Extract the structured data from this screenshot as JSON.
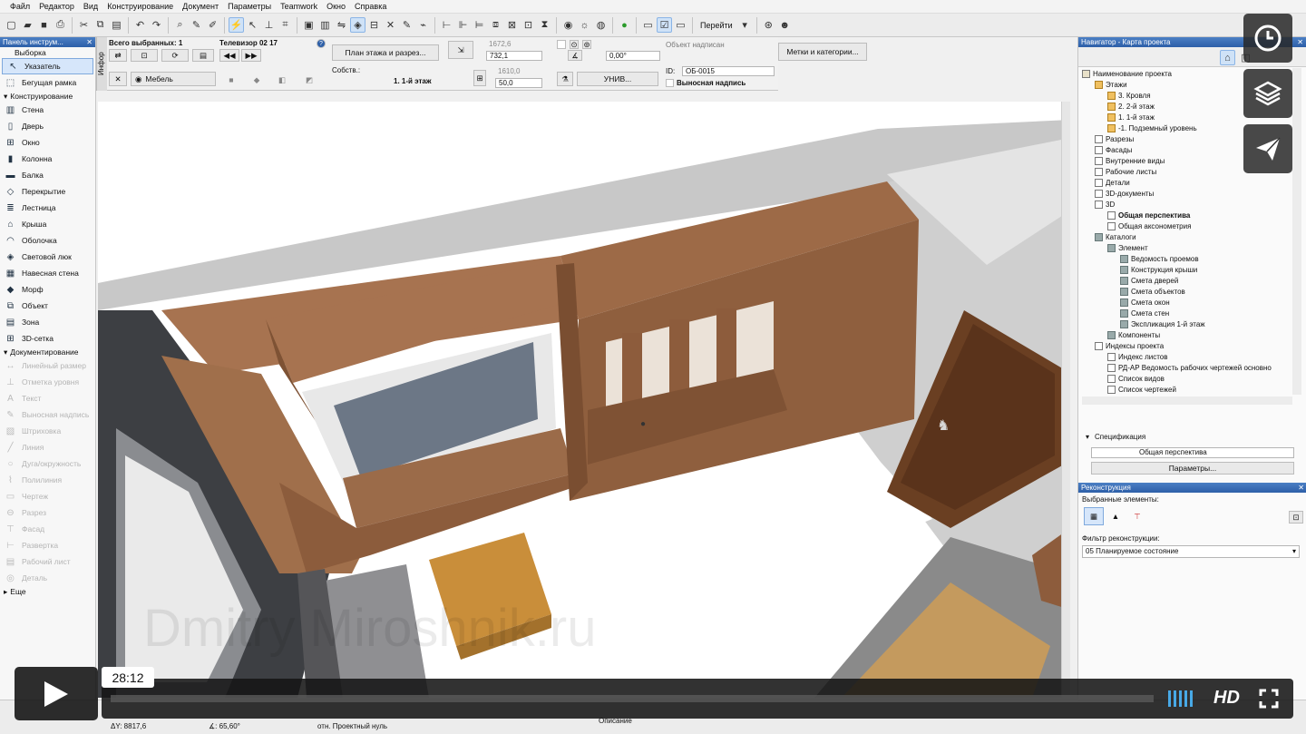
{
  "menu": [
    "Файл",
    "Редактор",
    "Вид",
    "Конструирование",
    "Документ",
    "Параметры",
    "Teamwork",
    "Окно",
    "Справка"
  ],
  "toolbar": {
    "goto_label": "Перейти"
  },
  "toolbox": {
    "title": "Панель инструм...",
    "selection_header": "Выборка",
    "selection_items": [
      {
        "label": "Указатель",
        "icon": "pointer-arrow-icon",
        "selected": true
      },
      {
        "label": "Бегущая рамка",
        "icon": "marquee-icon"
      }
    ],
    "design_header": "Конструирование",
    "design_items": [
      {
        "label": "Стена",
        "icon": "wall-icon"
      },
      {
        "label": "Дверь",
        "icon": "door-icon"
      },
      {
        "label": "Окно",
        "icon": "window-icon"
      },
      {
        "label": "Колонна",
        "icon": "column-icon"
      },
      {
        "label": "Балка",
        "icon": "beam-icon"
      },
      {
        "label": "Перекрытие",
        "icon": "slab-icon"
      },
      {
        "label": "Лестница",
        "icon": "stair-icon"
      },
      {
        "label": "Крыша",
        "icon": "roof-icon"
      },
      {
        "label": "Оболочка",
        "icon": "shell-icon"
      },
      {
        "label": "Световой люк",
        "icon": "skylight-icon"
      },
      {
        "label": "Навесная стена",
        "icon": "curtain-wall-icon"
      },
      {
        "label": "Морф",
        "icon": "morph-icon"
      },
      {
        "label": "Объект",
        "icon": "object-icon"
      },
      {
        "label": "Зона",
        "icon": "zone-icon"
      },
      {
        "label": "3D-сетка",
        "icon": "mesh-icon"
      }
    ],
    "doc_header": "Документирование",
    "doc_items": [
      {
        "label": "Линейный размер",
        "icon": "dimension-icon"
      },
      {
        "label": "Отметка уровня",
        "icon": "level-mark-icon"
      },
      {
        "label": "Текст",
        "icon": "text-icon"
      },
      {
        "label": "Выносная надпись",
        "icon": "label-icon"
      },
      {
        "label": "Штриховка",
        "icon": "fill-icon"
      },
      {
        "label": "Линия",
        "icon": "line-icon"
      },
      {
        "label": "Дуга/окружность",
        "icon": "arc-icon"
      },
      {
        "label": "Полилиния",
        "icon": "polyline-icon"
      },
      {
        "label": "Чертеж",
        "icon": "drawing-icon"
      },
      {
        "label": "Разрез",
        "icon": "section-icon"
      },
      {
        "label": "Фасад",
        "icon": "elevation-icon"
      },
      {
        "label": "Развертка",
        "icon": "interior-elevation-icon"
      },
      {
        "label": "Рабочий лист",
        "icon": "worksheet-icon"
      },
      {
        "label": "Деталь",
        "icon": "detail-icon"
      }
    ],
    "more_label": "Еще"
  },
  "infobox": {
    "vertical_label": "Инфор",
    "all_selected": "Всего выбранных: 1",
    "element_name": "Телевизор 02 17",
    "layer_value": "Мебель",
    "floor_plan_button": "План этажа и разрез...",
    "own_label": "Собств.:",
    "floor_value": "1. 1-й этаж",
    "width_value_1": "1672,6",
    "width_value_2": "732,1",
    "height_value_1": "1610,0",
    "height_value_2": "50,0",
    "angle_value": "0,00°",
    "univ_label": "УНИВ...",
    "object_label_title": "Объект надписан",
    "id_label": "ID:",
    "id_value": "ОБ-0015",
    "leader_label": "Выносная надпись",
    "tags_button": "Метки и категории..."
  },
  "navigator": {
    "title": "Навигатор - Карта проекта",
    "tree": [
      {
        "label": "Наименование проекта",
        "level": 0,
        "icon": "project"
      },
      {
        "label": "Этажи",
        "level": 1,
        "icon": "fold"
      },
      {
        "label": "3. Кровля",
        "level": 2,
        "icon": "fold"
      },
      {
        "label": "2. 2-й этаж",
        "level": 2,
        "icon": "fold"
      },
      {
        "label": "1. 1-й этаж",
        "level": 2,
        "icon": "fold"
      },
      {
        "label": "-1. Подземный уровень",
        "level": 2,
        "icon": "fold"
      },
      {
        "label": "Разрезы",
        "level": 1,
        "icon": "sheet"
      },
      {
        "label": "Фасады",
        "level": 1,
        "icon": "sheet"
      },
      {
        "label": "Внутренние виды",
        "level": 1,
        "icon": "sheet"
      },
      {
        "label": "Рабочие листы",
        "level": 1,
        "icon": "sheet"
      },
      {
        "label": "Детали",
        "level": 1,
        "icon": "sheet"
      },
      {
        "label": "3D-документы",
        "level": 1,
        "icon": "sheet"
      },
      {
        "label": "3D",
        "level": 1,
        "icon": "sheet"
      },
      {
        "label": "Общая перспектива",
        "level": 2,
        "icon": "sheet",
        "bold": true
      },
      {
        "label": "Общая аксонометрия",
        "level": 2,
        "icon": "sheet"
      },
      {
        "label": "Каталоги",
        "level": 1,
        "icon": "grid"
      },
      {
        "label": "Элемент",
        "level": 2,
        "icon": "grid"
      },
      {
        "label": "Ведомость проемов",
        "level": 3,
        "icon": "grid"
      },
      {
        "label": "Конструкция крыши",
        "level": 3,
        "icon": "grid"
      },
      {
        "label": "Смета дверей",
        "level": 3,
        "icon": "grid"
      },
      {
        "label": "Смета объектов",
        "level": 3,
        "icon": "grid"
      },
      {
        "label": "Смета окон",
        "level": 3,
        "icon": "grid"
      },
      {
        "label": "Смета стен",
        "level": 3,
        "icon": "grid"
      },
      {
        "label": "Экспликация 1-й этаж",
        "level": 3,
        "icon": "grid"
      },
      {
        "label": "Компоненты",
        "level": 2,
        "icon": "grid"
      },
      {
        "label": "Индексы проекта",
        "level": 1,
        "icon": "sheet"
      },
      {
        "label": "Индекс листов",
        "level": 2,
        "icon": "sheet"
      },
      {
        "label": "РД-АР Ведомость рабочих чертежей основно",
        "level": 2,
        "icon": "sheet"
      },
      {
        "label": "Список видов",
        "level": 2,
        "icon": "sheet"
      },
      {
        "label": "Список чертежей",
        "level": 2,
        "icon": "sheet"
      }
    ],
    "spec_label": "Спецификация",
    "spec_value": "Общая перспектива",
    "params_button": "Параметры..."
  },
  "renovation": {
    "title": "Реконструкция",
    "selected_label": "Выбранные элементы:",
    "filter_label": "Фильтр реконструкции:",
    "filter_value": "05 Планируемое состояние"
  },
  "statusbar": {
    "dx_label": "ΔY: 8817,6",
    "angle_label": "∡: 65,60°",
    "ref_label": "отн. Проектный нуль",
    "overlay_label": "Описание"
  },
  "video": {
    "time": "28:12",
    "hd_label": "HD",
    "watermark": "Dmitry Miroshnik.ru"
  }
}
